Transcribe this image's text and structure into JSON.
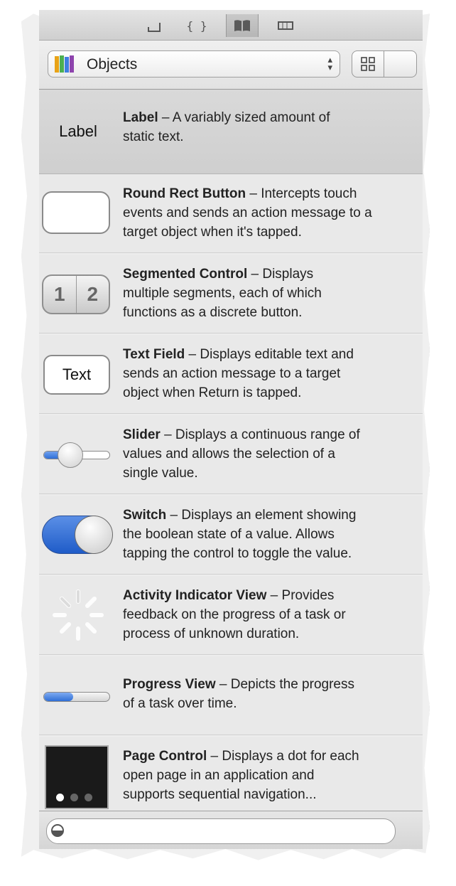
{
  "library": {
    "selector_label": "Objects",
    "view_modes": [
      "grid-view-icon",
      "list-view-icon"
    ],
    "active_view": "list"
  },
  "tabs": [
    "file-template-icon",
    "code-snippet-icon",
    "object-library-icon",
    "media-library-icon"
  ],
  "items": [
    {
      "name": "Label",
      "desc_lines": [
        " – A variably sized amount of",
        "static text."
      ],
      "thumb_text": "Label"
    },
    {
      "name": "Round Rect Button",
      "desc_lines": [
        " – Intercepts touch",
        "events and sends an action message to a",
        "target object when it's tapped."
      ]
    },
    {
      "name": "Segmented Control",
      "desc_lines": [
        " – Displays",
        "multiple segments, each of which",
        "functions as a discrete button."
      ],
      "thumb_text": [
        "1",
        "2"
      ]
    },
    {
      "name": "Text Field",
      "desc_lines": [
        " – Displays editable text and",
        "sends an action message to a target",
        "object when Return is tapped."
      ],
      "thumb_text": "Text"
    },
    {
      "name": "Slider",
      "desc_lines": [
        " – Displays a continuous range of",
        "values and allows the selection of a",
        "single value."
      ]
    },
    {
      "name": "Switch",
      "desc_lines": [
        " – Displays an element showing",
        "the boolean state of a value. Allows",
        "tapping the control to toggle the value."
      ]
    },
    {
      "name": "Activity Indicator View",
      "desc_lines": [
        " – Provides",
        "feedback on the progress of a task or",
        "process of unknown duration."
      ]
    },
    {
      "name": "Progress View",
      "desc_lines": [
        " – Depicts the progress",
        "of a task over time."
      ]
    },
    {
      "name": "Page Control",
      "desc_lines": [
        " – Displays a dot for each",
        "open page in an application and",
        "supports sequential navigation..."
      ]
    }
  ],
  "slider_value": 0.4,
  "progress_value": 0.45,
  "switch_on": true,
  "colors": {
    "accent_blue": "#2f6fd6",
    "selected_row": "#d4d4d4",
    "row": "#e9e9e9"
  }
}
